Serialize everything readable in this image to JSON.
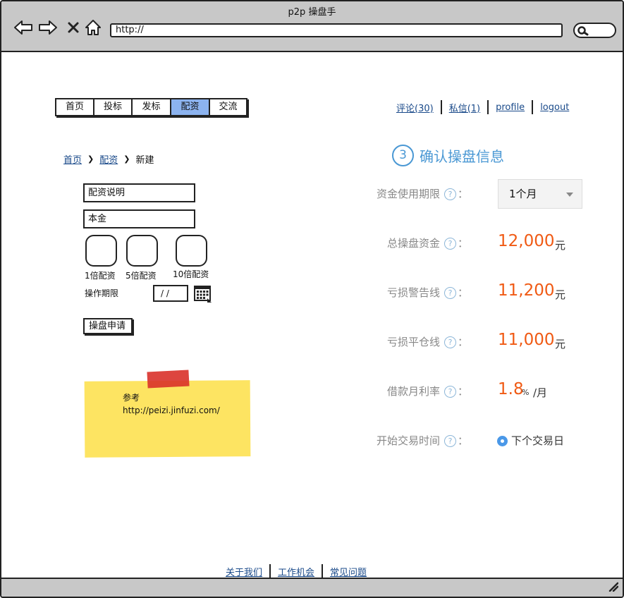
{
  "window": {
    "title": "p2p 操盘手",
    "url": "http://"
  },
  "icons": {
    "back": "back-arrow-icon",
    "forward": "forward-arrow-icon",
    "stop": "close-icon",
    "home": "home-icon",
    "search": "search-icon",
    "calendar": "calendar-icon",
    "resize": "resize-grip-icon",
    "help": "question-icon"
  },
  "nav": {
    "tabs": [
      "首页",
      "投标",
      "发标",
      "配资",
      "交流"
    ],
    "active": "配资"
  },
  "user_links": [
    "评论(30)",
    "私信(1)",
    "profile",
    "logout"
  ],
  "breadcrumb": {
    "home": "首页",
    "section": "配资",
    "current": "新建"
  },
  "form": {
    "description": "配资说明",
    "principal": "本金",
    "multipliers": [
      "1倍配资",
      "5倍配资",
      "10倍配资"
    ],
    "period_label": "操作期限",
    "date_value": "/ /",
    "submit": "操盘申请"
  },
  "note": {
    "line1": "参考",
    "line2": "http://peizi.jinfuzi.com/"
  },
  "confirm": {
    "step_number": "3",
    "title": "确认操盘信息",
    "term_label": "资金使用期限",
    "term_value": "1个月",
    "total_label": "总操盘资金",
    "total_value": "12,000",
    "total_unit": "元",
    "warning_label": "亏损警告线",
    "warning_value": "11,200",
    "warning_unit": "元",
    "liquidation_label": "亏损平仓线",
    "liquidation_value": "11,000",
    "liquidation_unit": "元",
    "rate_label": "借款月利率",
    "rate_value": "1.8",
    "rate_percent": "%",
    "rate_unit": "/月",
    "start_label": "开始交易时间",
    "start_value": "下个交易日",
    "help_glyph": "?",
    "colon": "："
  },
  "footer": [
    "关于我们",
    "工作机会",
    "常见问题"
  ]
}
